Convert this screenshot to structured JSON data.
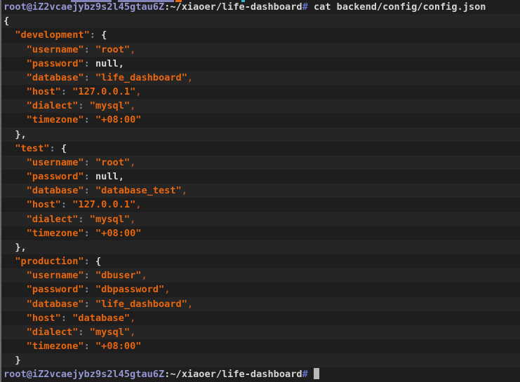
{
  "colors": {
    "background": "#1e1e1e",
    "stripe_light": "#252526",
    "stripe_dark": "#1e1e1e",
    "orange": "#e8660d",
    "white": "#d6d6d6",
    "prompt_user": "#9597d2",
    "prompt_hash": "#6471c9",
    "colon": "#80849e",
    "comma_after_string": "#b05020",
    "cursor": "#b8b8b8",
    "left_border": "#6d6d6d"
  },
  "terminal": {
    "prompt": {
      "user_host": "root@iZ2vcaejybz9s2l45gtau6Z",
      "cwd": "~/xiaoer/life-dashboard",
      "symbol": "#"
    },
    "command": "cat backend/config/config.json",
    "cursor_line": 26,
    "lines": [
      [
        [
          "user",
          "root@iZ2vcaejybz9s2l45gtau6Z"
        ],
        [
          "plain",
          ":~/xiaoer/life-dashboard"
        ],
        [
          "hash",
          "#"
        ],
        [
          "plain",
          " cat backend/config/config.json"
        ]
      ],
      [
        [
          "plain",
          "{"
        ]
      ],
      [
        [
          "plain",
          "  "
        ],
        [
          "key",
          "\"development\""
        ],
        [
          "colon",
          ":"
        ],
        [
          "plain",
          " {"
        ]
      ],
      [
        [
          "plain",
          "    "
        ],
        [
          "key",
          "\"username\""
        ],
        [
          "colon",
          ":"
        ],
        [
          "plain",
          " "
        ],
        [
          "str",
          "\"root\""
        ],
        [
          "comma",
          ","
        ]
      ],
      [
        [
          "plain",
          "    "
        ],
        [
          "key",
          "\"password\""
        ],
        [
          "colon",
          ":"
        ],
        [
          "plain",
          " null,"
        ]
      ],
      [
        [
          "plain",
          "    "
        ],
        [
          "key",
          "\"database\""
        ],
        [
          "colon",
          ":"
        ],
        [
          "plain",
          " "
        ],
        [
          "str",
          "\"life_dashboard\""
        ],
        [
          "comma",
          ","
        ]
      ],
      [
        [
          "plain",
          "    "
        ],
        [
          "key",
          "\"host\""
        ],
        [
          "colon",
          ":"
        ],
        [
          "plain",
          " "
        ],
        [
          "str",
          "\"127.0.0.1\""
        ],
        [
          "comma",
          ","
        ]
      ],
      [
        [
          "plain",
          "    "
        ],
        [
          "key",
          "\"dialect\""
        ],
        [
          "colon",
          ":"
        ],
        [
          "plain",
          " "
        ],
        [
          "str",
          "\"mysql\""
        ],
        [
          "comma",
          ","
        ]
      ],
      [
        [
          "plain",
          "    "
        ],
        [
          "key",
          "\"timezone\""
        ],
        [
          "colon",
          ":"
        ],
        [
          "plain",
          " "
        ],
        [
          "str",
          "\"+08:00\""
        ]
      ],
      [
        [
          "plain",
          "  },"
        ]
      ],
      [
        [
          "plain",
          "  "
        ],
        [
          "key",
          "\"test\""
        ],
        [
          "colon",
          ":"
        ],
        [
          "plain",
          " {"
        ]
      ],
      [
        [
          "plain",
          "    "
        ],
        [
          "key",
          "\"username\""
        ],
        [
          "colon",
          ":"
        ],
        [
          "plain",
          " "
        ],
        [
          "str",
          "\"root\""
        ],
        [
          "comma",
          ","
        ]
      ],
      [
        [
          "plain",
          "    "
        ],
        [
          "key",
          "\"password\""
        ],
        [
          "colon",
          ":"
        ],
        [
          "plain",
          " null,"
        ]
      ],
      [
        [
          "plain",
          "    "
        ],
        [
          "key",
          "\"database\""
        ],
        [
          "colon",
          ":"
        ],
        [
          "plain",
          " "
        ],
        [
          "str",
          "\"database_test\""
        ],
        [
          "comma",
          ","
        ]
      ],
      [
        [
          "plain",
          "    "
        ],
        [
          "key",
          "\"host\""
        ],
        [
          "colon",
          ":"
        ],
        [
          "plain",
          " "
        ],
        [
          "str",
          "\"127.0.0.1\""
        ],
        [
          "comma",
          ","
        ]
      ],
      [
        [
          "plain",
          "    "
        ],
        [
          "key",
          "\"dialect\""
        ],
        [
          "colon",
          ":"
        ],
        [
          "plain",
          " "
        ],
        [
          "str",
          "\"mysql\""
        ],
        [
          "comma",
          ","
        ]
      ],
      [
        [
          "plain",
          "    "
        ],
        [
          "key",
          "\"timezone\""
        ],
        [
          "colon",
          ":"
        ],
        [
          "plain",
          " "
        ],
        [
          "str",
          "\"+08:00\""
        ]
      ],
      [
        [
          "plain",
          "  },"
        ]
      ],
      [
        [
          "plain",
          "  "
        ],
        [
          "key",
          "\"production\""
        ],
        [
          "colon",
          ":"
        ],
        [
          "plain",
          " {"
        ]
      ],
      [
        [
          "plain",
          "    "
        ],
        [
          "key",
          "\"username\""
        ],
        [
          "colon",
          ":"
        ],
        [
          "plain",
          " "
        ],
        [
          "str",
          "\"dbuser\""
        ],
        [
          "comma",
          ","
        ]
      ],
      [
        [
          "plain",
          "    "
        ],
        [
          "key",
          "\"password\""
        ],
        [
          "colon",
          ":"
        ],
        [
          "plain",
          " "
        ],
        [
          "str",
          "\"dbpassword\""
        ],
        [
          "comma",
          ","
        ]
      ],
      [
        [
          "plain",
          "    "
        ],
        [
          "key",
          "\"database\""
        ],
        [
          "colon",
          ":"
        ],
        [
          "plain",
          " "
        ],
        [
          "str",
          "\"life_dashboard\""
        ],
        [
          "comma",
          ","
        ]
      ],
      [
        [
          "plain",
          "    "
        ],
        [
          "key",
          "\"host\""
        ],
        [
          "colon",
          ":"
        ],
        [
          "plain",
          " "
        ],
        [
          "str",
          "\"database\""
        ],
        [
          "comma",
          ","
        ]
      ],
      [
        [
          "plain",
          "    "
        ],
        [
          "key",
          "\"dialect\""
        ],
        [
          "colon",
          ":"
        ],
        [
          "plain",
          " "
        ],
        [
          "str",
          "\"mysql\""
        ],
        [
          "comma",
          ","
        ]
      ],
      [
        [
          "plain",
          "    "
        ],
        [
          "key",
          "\"timezone\""
        ],
        [
          "colon",
          ":"
        ],
        [
          "plain",
          " "
        ],
        [
          "str",
          "\"+08:00\""
        ]
      ],
      [
        [
          "plain",
          "  }"
        ]
      ],
      [
        [
          "user",
          "root@iZ2vcaejybz9s2l45gtau6Z"
        ],
        [
          "plain",
          ":~/xiaoer/life-dashboard"
        ],
        [
          "hash",
          "#"
        ],
        [
          "plain",
          " "
        ]
      ]
    ]
  }
}
